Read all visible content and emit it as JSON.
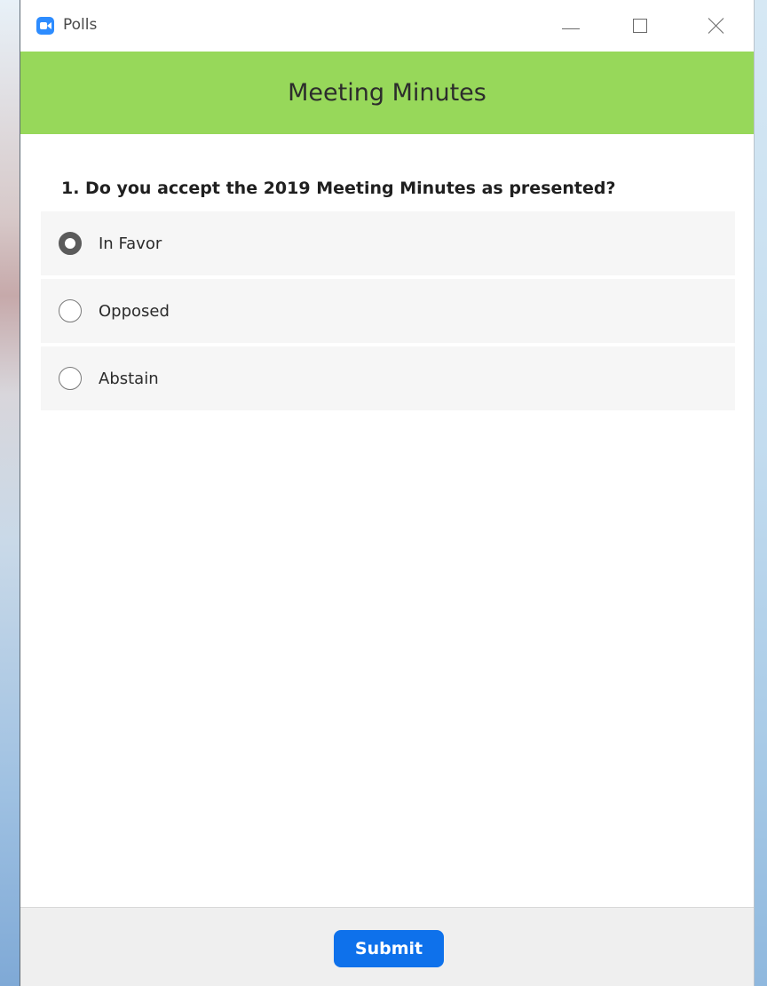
{
  "window": {
    "title": "Polls",
    "icon": "zoom-camera-icon",
    "controls": [
      "minimize-icon",
      "maximize-icon",
      "close-icon"
    ]
  },
  "poll": {
    "title": "Meeting Minutes",
    "header_color": "#97d85a",
    "question": "1. Do you accept the 2019 Meeting Minutes as presented?",
    "options": [
      {
        "label": "In Favor",
        "selected": true
      },
      {
        "label": "Opposed",
        "selected": false
      },
      {
        "label": "Abstain",
        "selected": false
      }
    ]
  },
  "footer": {
    "submit_label": "Submit",
    "submit_color": "#0e71eb"
  }
}
